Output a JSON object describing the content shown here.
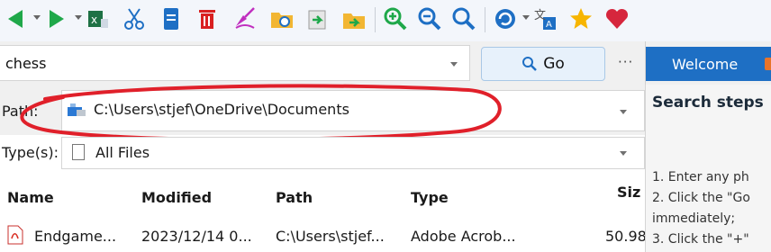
{
  "search": {
    "query": "chess",
    "go_label": "Go",
    "more_label": "···"
  },
  "welcome_tab": {
    "label": "Welcome"
  },
  "path": {
    "label": "Path:",
    "value": "C:\\Users\\stjef\\OneDrive\\Documents"
  },
  "type": {
    "label": "Type(s):",
    "value": "All Files"
  },
  "columns": {
    "name": "Name",
    "modified": "Modified",
    "path": "Path",
    "type": "Type",
    "size": "Siz"
  },
  "rows": [
    {
      "name": "Endgame...",
      "modified": "2023/12/14 0...",
      "path": "C:\\Users\\stjef...",
      "type": "Adobe Acrob...",
      "size": "50.98"
    }
  ],
  "panel": {
    "title": "Search steps",
    "steps": [
      "1. Enter any ph",
      "2. Click the \"Go",
      "immediately;",
      "3. Click the \"+\""
    ]
  },
  "toolbar_icons": [
    "back-arrow-icon",
    "forward-arrow-icon",
    "excel-icon",
    "cut-icon",
    "document-icon",
    "delete-icon",
    "clear-icon",
    "folder-search-icon",
    "import-icon",
    "export-icon",
    "zoom-in-icon",
    "zoom-out-icon",
    "search-icon",
    "refresh-icon",
    "translate-icon",
    "star-icon",
    "heart-icon"
  ],
  "colors": {
    "accent": "#1e6fc4",
    "annotation": "#e0202a",
    "toolbar_bg": "#f3f6fb"
  }
}
